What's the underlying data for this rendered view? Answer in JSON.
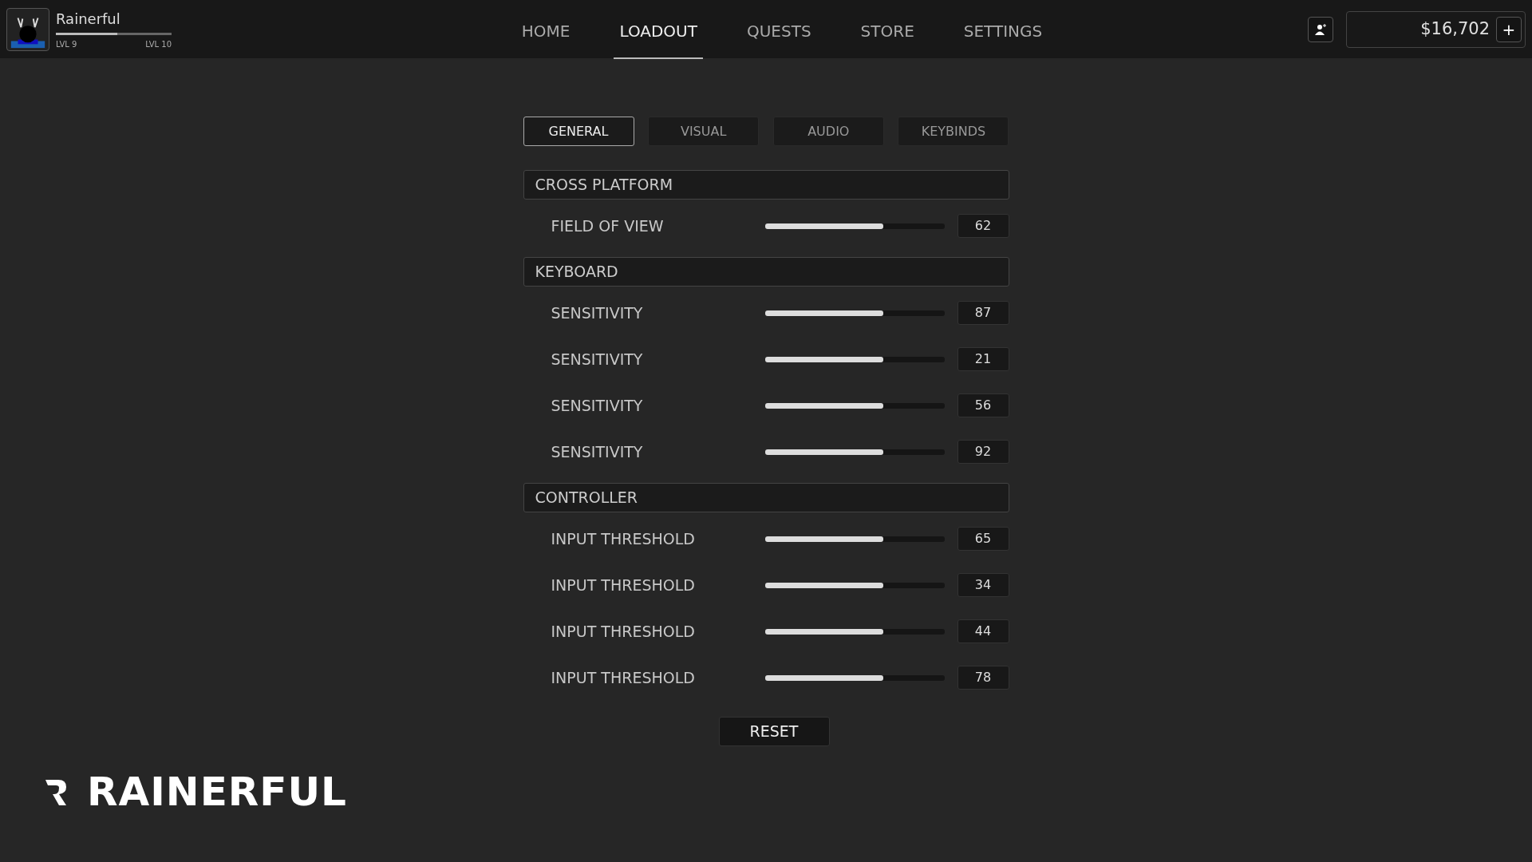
{
  "player": {
    "name": "Rainerful",
    "level_current": "LVL 9",
    "level_next": "LVL 10",
    "level": 0.53
  },
  "nav": [
    {
      "label": "HOME",
      "selected": false
    },
    {
      "label": "LOADOUT",
      "selected": true
    },
    {
      "label": "QUESTS",
      "selected": false
    },
    {
      "label": "STORE",
      "selected": false
    },
    {
      "label": "SETTINGS",
      "selected": false
    }
  ],
  "wallet": {
    "balance": "$16,702",
    "add_label": "+"
  },
  "tabs": [
    {
      "label": "GENERAL",
      "selected": true
    },
    {
      "label": "VISUAL",
      "selected": false
    },
    {
      "label": "AUDIO",
      "selected": false
    },
    {
      "label": "KEYBINDS",
      "selected": false
    }
  ],
  "sections": [
    {
      "title": "CROSS PLATFORM",
      "settings": [
        {
          "label": "FIELD OF VIEW",
          "level": 0.66,
          "value": "62"
        }
      ]
    },
    {
      "title": "KEYBOARD",
      "settings": [
        {
          "label": "SENSITIVITY",
          "level": 0.66,
          "value": "87"
        },
        {
          "label": "SENSITIVITY",
          "level": 0.66,
          "value": "21"
        },
        {
          "label": "SENSITIVITY",
          "level": 0.66,
          "value": "56"
        },
        {
          "label": "SENSITIVITY",
          "level": 0.66,
          "value": "92"
        }
      ]
    },
    {
      "title": "CONTROLLER",
      "settings": [
        {
          "label": "INPUT THRESHOLD",
          "level": 0.66,
          "value": "65"
        },
        {
          "label": "INPUT THRESHOLD",
          "level": 0.66,
          "value": "34"
        },
        {
          "label": "INPUT THRESHOLD",
          "level": 0.66,
          "value": "44"
        },
        {
          "label": "INPUT THRESHOLD",
          "level": 0.66,
          "value": "78"
        }
      ]
    }
  ],
  "reset_label": "RESET",
  "brand": "RAINERFUL"
}
